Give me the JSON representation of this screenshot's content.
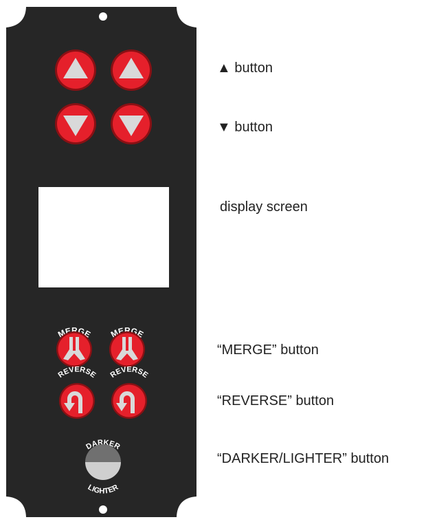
{
  "colors": {
    "panel": "#262626",
    "button_red": "#e5202b",
    "button_dark_ring": "#8a1014",
    "button_glyph": "#d9d9d9",
    "screen": "#ffffff",
    "darker_top": "#707070",
    "darker_bottom": "#cfcfcf",
    "label_text": "#222222"
  },
  "panel": {
    "up_button_icon": "triangle-up-icon",
    "down_button_icon": "triangle-down-icon",
    "merge_label_left": "MERGE",
    "merge_label_right": "MERGE",
    "reverse_label_left": "REVERSE",
    "reverse_label_right": "REVERSE",
    "darker_label": "DARKER",
    "lighter_label": "LIGHTER"
  },
  "labels": {
    "up": "▲ button",
    "down": "▼ button",
    "screen": "display screen",
    "merge": "“MERGE” button",
    "reverse": "“REVERSE” button",
    "darker_lighter": "“DARKER/LIGHTER” button"
  }
}
